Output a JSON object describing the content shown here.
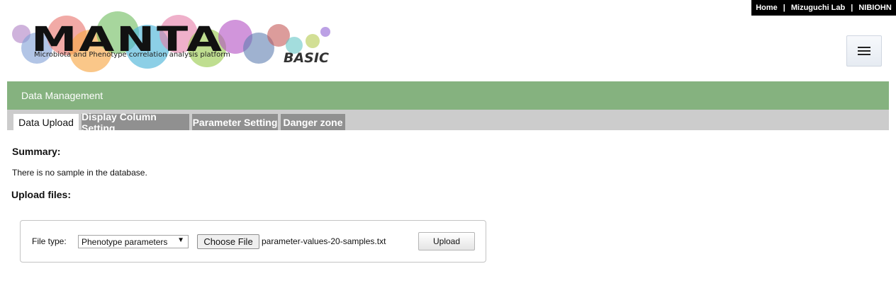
{
  "topnav": {
    "home": "Home",
    "lab": "Mizuguchi Lab",
    "org": "NIBIOHN",
    "separator": "|"
  },
  "logo": {
    "word": "MANTA",
    "subtitle": "Microbiota and Phenotype correlation analysis platform",
    "edition": "BASIC"
  },
  "menu": {
    "icon": "hamburger-icon"
  },
  "section": {
    "title": "Data Management"
  },
  "tabs": [
    {
      "label": "Data Upload",
      "active": true
    },
    {
      "label": "Display Column Setting",
      "active": false
    },
    {
      "label": "Parameter Setting",
      "active": false
    },
    {
      "label": "Danger zone",
      "active": false
    }
  ],
  "summary": {
    "title": "Summary:",
    "text": "There is no sample in the database."
  },
  "upload": {
    "title": "Upload files:",
    "file_type_label": "File type:",
    "file_type_value": "Phenotype parameters",
    "choose_label": "Choose File",
    "file_name": "parameter-values-20-samples.txt",
    "upload_label": "Upload"
  },
  "colors": {
    "section_bar": "#85b27f",
    "tab_bar": "#cccccc",
    "tab_inactive": "#909090",
    "topnav_bg": "#000000"
  }
}
